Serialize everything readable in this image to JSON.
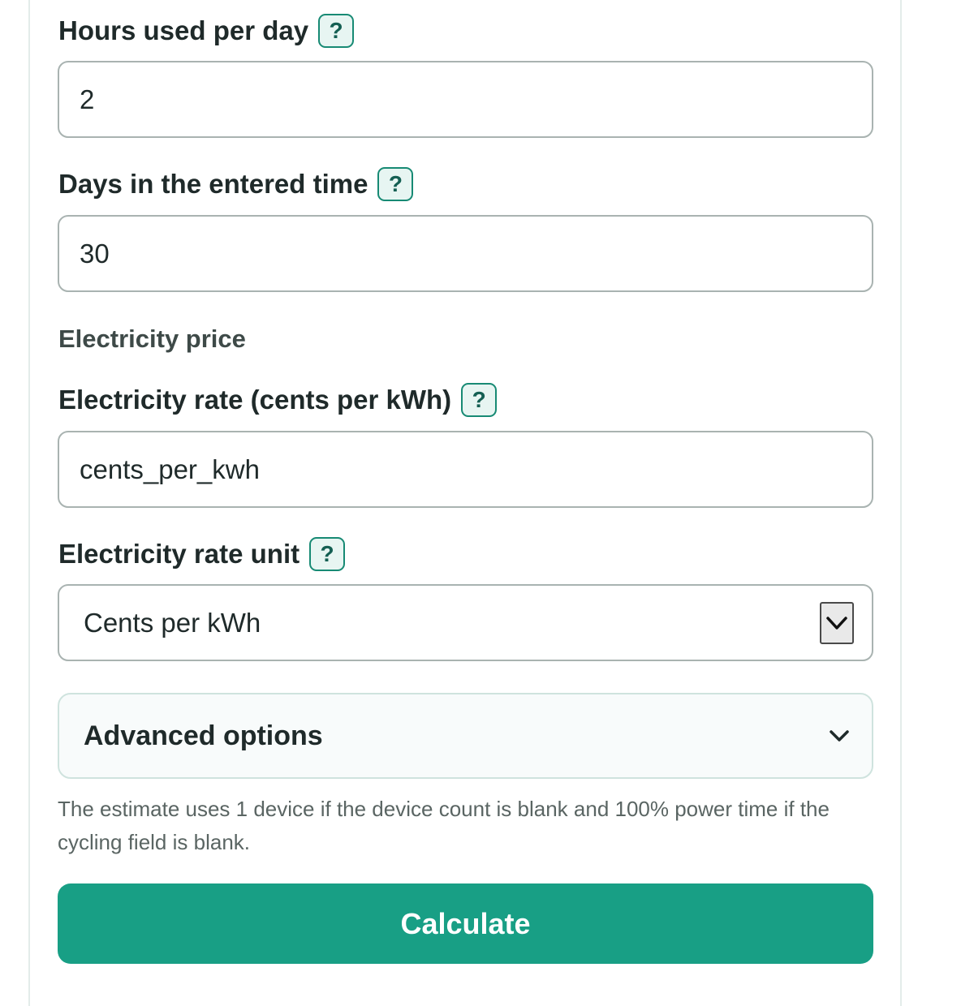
{
  "hours_field": {
    "label": "Hours used per day",
    "help": "?",
    "value": "2"
  },
  "days_field": {
    "label": "Days in the entered time",
    "help": "?",
    "value": "30"
  },
  "price_section": {
    "heading": "Electricity price"
  },
  "rate_field": {
    "label": "Electricity rate (cents per kWh)",
    "help": "?",
    "value": "cents_per_kwh"
  },
  "unit_field": {
    "label": "Electricity rate unit",
    "help": "?",
    "selected": "Cents per kWh",
    "arrow_icon": "chevron-down-icon"
  },
  "advanced": {
    "label": "Advanced options",
    "icon": "chevron-down-icon"
  },
  "note": "The estimate uses 1 device if the device count is blank and 100% power time if the cycling field is blank.",
  "calculate_label": "Calculate",
  "colors": {
    "accent": "#189f85",
    "help_border": "#178a74",
    "help_background": "#e7f5f2"
  }
}
